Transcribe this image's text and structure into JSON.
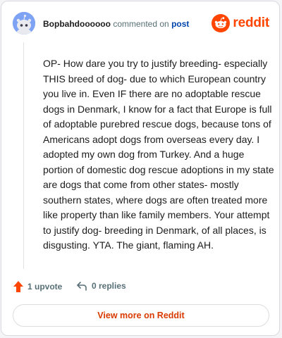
{
  "header": {
    "username": "Bopbahdoooooo",
    "commented_on": "commented on",
    "post_link": "post",
    "brand_name": "reddit",
    "brand_color": "#ff4500",
    "avatar_color": "#7ea2f4"
  },
  "comment": {
    "text": "OP- How dare you try to justify breeding- especially THIS breed of dog- due to which European country you live in. Even IF there are no adoptable rescue dogs in Denmark, I know for a fact that Europe is full of adoptable purebred rescue dogs, because tons of Americans adopt dogs from overseas every day. I adopted my own dog from Turkey. And a huge portion of domestic dog rescue adoptions in my state are dogs that come from other states- mostly southern states, where dogs are often treated more like property than like family members. Your attempt to justify dog- breeding in Denmark, of all places, is disgusting. YTA. The giant, flaming AH."
  },
  "actions": {
    "upvote_icon": "upvote-arrow-icon",
    "upvote_label": "1 upvote",
    "reply_icon": "reply-arrow-icon",
    "replies_label": "0 replies"
  },
  "footer": {
    "view_more_label": "View more on Reddit",
    "view_more_color": "#d93a00"
  }
}
